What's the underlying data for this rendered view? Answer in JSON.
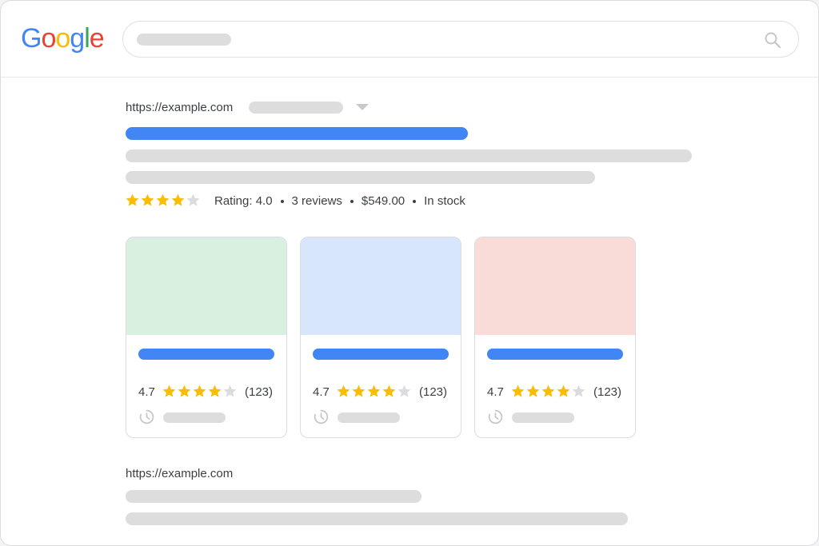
{
  "header": {
    "logo_letters": [
      {
        "char": "G",
        "color": "#4285F4"
      },
      {
        "char": "o",
        "color": "#EA4335"
      },
      {
        "char": "o",
        "color": "#FBBC05"
      },
      {
        "char": "g",
        "color": "#4285F4"
      },
      {
        "char": "l",
        "color": "#34A853"
      },
      {
        "char": "e",
        "color": "#EA4335"
      }
    ],
    "search_icon": "search-icon"
  },
  "result1": {
    "url": "https://example.com",
    "rating_text": "Rating: 4.0",
    "reviews": "3 reviews",
    "price": "$549.00",
    "stock": "In stock",
    "stars": 4,
    "stars_max": 5
  },
  "cards": [
    {
      "rating": "4.7",
      "count": "(123)",
      "stars": 4,
      "thumb_color": "#d9efdf",
      "icon": "clock-icon"
    },
    {
      "rating": "4.7",
      "count": "(123)",
      "stars": 4,
      "thumb_color": "#d7e6fb",
      "icon": "clock-icon"
    },
    {
      "rating": "4.7",
      "count": "(123)",
      "stars": 4,
      "thumb_color": "#f9dbd7",
      "icon": "clock-icon"
    }
  ],
  "result2": {
    "url": "https://example.com"
  },
  "colors": {
    "link_blue": "#4285f4",
    "star_gold": "#fbbc04",
    "star_empty": "#dadce0",
    "placeholder_gray": "#dddddd"
  }
}
